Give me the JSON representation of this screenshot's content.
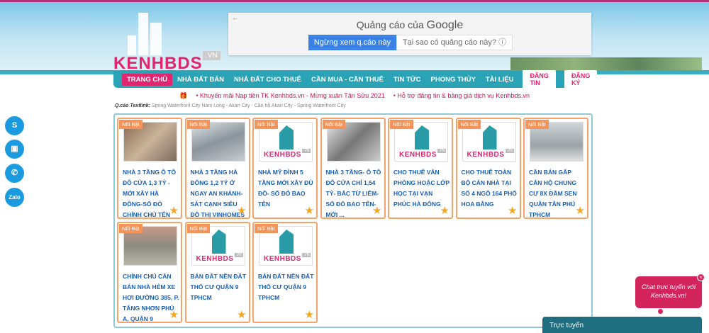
{
  "header": {
    "logo_text": "KENHBDS",
    "logo_suffix": ".VN"
  },
  "ad": {
    "back": "←",
    "title_prefix": "Quảng cáo của",
    "title_brand": "Google",
    "stop_button": "Ngừng xem q.cáo này",
    "why_button": "Tại sao có quảng cáo này? ⓘ"
  },
  "nav": {
    "items": [
      "TRANG CHỦ",
      "NHÀ ĐẤT BÁN",
      "NHÀ ĐẤT CHO THUÊ",
      "CẦN MUA - CẦN THUÊ",
      "TIN TỨC",
      "PHONG THỦY",
      "TÀI LIỆU"
    ],
    "post_button": "ĐĂNG TIN",
    "register_button": "ĐĂNG KÝ"
  },
  "promo": {
    "items": [
      "• Khuyến mãi Nạp tiền TK Kenhbds.vn - Mừng xuân Tân Sửu 2021",
      "• Hỗ trợ đăng tin & bảng giá dịch vụ Kenhbds.vn"
    ]
  },
  "textlink": {
    "label": "Q.cáo Textlink:",
    "value": "Spring Waterfront City Nam Long - Akari City - Căn hộ Akari City - Spring Waterfront City"
  },
  "badge_label": "Nổi Bật",
  "listings": [
    {
      "title": "NHÀ 3 TẦNG Ô TÔ ĐỖ CỬA 1,3 TỶ - MỚI XÂY HÀ ĐÔNG-SỔ ĐỎ CHÍNH CHỦ TÊN",
      "image": "photo"
    },
    {
      "title": "NHÀ 3 TẦNG HÀ ĐÔNG 1,2 TỶ Ở NGAY AN KHÁNH-SÁT CẠNH SIÊU ĐÔ THỊ VINHOMES",
      "image": "photo2"
    },
    {
      "title": "NHÀ MỸ ĐÌNH 5 TẦNG MỚI XÂY ĐỦ ĐỒ- SỔ ĐỎ BAO TÊN",
      "image": "logo"
    },
    {
      "title": "NHÀ 3 TẦNG- Ô TÔ ĐỖ CỬA CHỈ 1,54 TỶ- BẮC TỪ LIÊM-SỔ ĐỎ BAO TÊN-MỚI ...",
      "image": "photo3"
    },
    {
      "title": "CHO THUÊ VĂN PHÒNG HOẶC LỚP HỌC TẠI VẠN PHÚC HÀ ĐÔNG",
      "image": "logo"
    },
    {
      "title": "CHO THUÊ TOÀN BỘ CĂN NHÀ TẠI SỐ 4 NGÕ 164 PHỐ HOA BẰNG",
      "image": "logo"
    },
    {
      "title": "CẦN BÁN GẤP CĂN HỘ CHUNG CƯ 8X ĐẦM SEN QUẬN TÂN PHÚ TPHCM",
      "image": "photo4"
    },
    {
      "title": "CHÍNH CHỦ CẦN BÁN NHÀ HẺM XE HƠI ĐƯỜNG 385, P. TĂNG NHƠN PHÚ A, QUẬN 9",
      "image": "photo5"
    },
    {
      "title": "BÁN ĐẤT NỀN ĐẤT THỔ CƯ QUẬN 9 TPHCM",
      "image": "logo"
    },
    {
      "title": "BÁN ĐẤT NỀN ĐẤT THỔ CƯ QUẬN 9 TPHCM",
      "image": "logo"
    }
  ],
  "side_icons": [
    "skype-icon",
    "briefcase-icon",
    "phone-icon",
    "zalo-icon"
  ],
  "side_zalo": "Zalo",
  "chat": {
    "bubble": "Chat trực tuyến với Kenhbds.vn!",
    "close": "×",
    "bar": "Trực tuyến"
  }
}
